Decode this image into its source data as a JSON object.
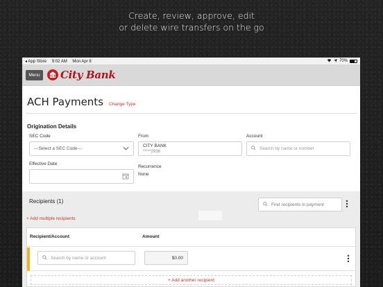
{
  "tagline": {
    "line1": "Create, review, approve, edit",
    "line2": "or delete wire transfers on the go"
  },
  "statusbar": {
    "carrier": "◂ App Store",
    "time": "9:02 AM",
    "date": "Mon Apr 8",
    "battery": "70%"
  },
  "appbar": {
    "menu_label": "Menu",
    "brand": "City Bank"
  },
  "page": {
    "title": "ACH Payments",
    "change_type": "Change Type"
  },
  "origination": {
    "title": "Origination Details",
    "sec_code_label": "SEC Code",
    "sec_code_value": "---Select a SEC Code---",
    "from_label": "From",
    "from_name": "CITY BANK",
    "from_account": "*****2936",
    "account_label": "Account",
    "account_placeholder": "Search by name or number",
    "effective_date_label": "Effective Date",
    "effective_date_value": "",
    "recurrence_label": "Recurrence",
    "recurrence_value": "None"
  },
  "recipients": {
    "title": "Recipients (1)",
    "search_placeholder": "Find recipients in payment",
    "add_multiple": "+ Add multiple recipients",
    "col_recipient": "Recipient/Account",
    "col_amount": "Amount",
    "row": {
      "search_placeholder": "Search by name or account",
      "amount": "$0.00"
    },
    "add_another": "+ Add another recipient"
  },
  "colors": {
    "accent": "#c0392b",
    "brand": "#b1121b",
    "row_marker": "#f0b323"
  }
}
